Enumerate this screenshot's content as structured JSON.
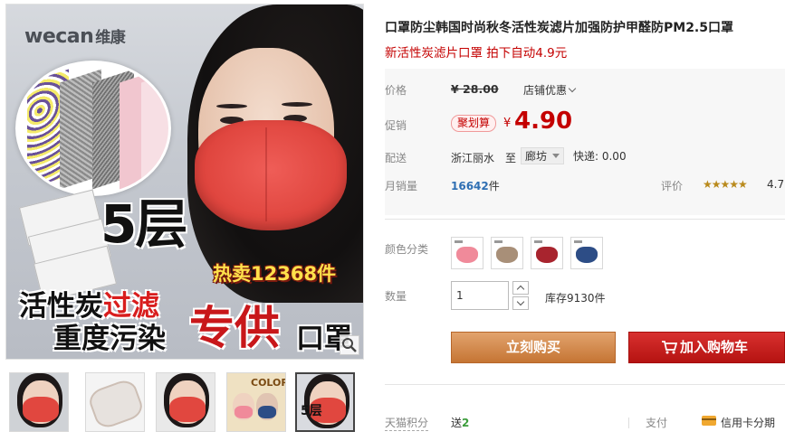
{
  "gallery": {
    "brand_en": "wecan",
    "brand_cn": "维康",
    "layers_text": "5层",
    "hot_sale_text": "热卖12368件",
    "line1_black": "活性炭",
    "line1_red": "过滤",
    "line2_black": "重度污染",
    "line2_red": "专供",
    "line2_end": "口罩",
    "zoom_icon": "magnifier-icon",
    "thumbs": [
      {
        "kind": "woman-mask"
      },
      {
        "kind": "mask-flat"
      },
      {
        "kind": "woman-mask"
      },
      {
        "kind": "color-collage",
        "label": "COLOR"
      },
      {
        "kind": "woman-mask-text",
        "label": "5层"
      }
    ]
  },
  "product": {
    "title": "口罩防尘韩国时尚秋冬活性炭滤片加强防护甲醛防PM2.5口罩",
    "subtitle": "新活性炭滤片口罩 拍下自动4.9元"
  },
  "price_panel": {
    "price_label": "价格",
    "orig_price": "¥ 28.00",
    "store_discount": "店铺优惠",
    "promo_label": "促销",
    "promo_badge": "聚划算",
    "currency": "¥",
    "promo_price": "4.90",
    "ship_label": "配送",
    "ship_from": "浙江丽水",
    "ship_to_word": "至",
    "ship_city": "廊坊",
    "express": "快递: 0.00",
    "monthly_label": "月销量",
    "monthly_sales": "16642",
    "monthly_unit": "件",
    "review_label": "评价",
    "stars": "★★★★★",
    "rating": "4.7"
  },
  "options": {
    "color_label": "颜色分类",
    "swatch_colors": [
      "#f08a9a",
      "#a88f78",
      "#a8242e",
      "#2d4d86"
    ],
    "qty_label": "数量",
    "qty_value": "1",
    "stock": "库存9130件"
  },
  "actions": {
    "buy_now": "立刻购买",
    "add_cart": "加入购物车",
    "cart_icon": "cart-icon"
  },
  "footer": {
    "tmall_points_label": "天猫积分",
    "gift_prefix": "送",
    "gift_points": "2",
    "pay_label": "支付",
    "card_icon": "credit-card-icon",
    "credit_text": "信用卡分期"
  }
}
